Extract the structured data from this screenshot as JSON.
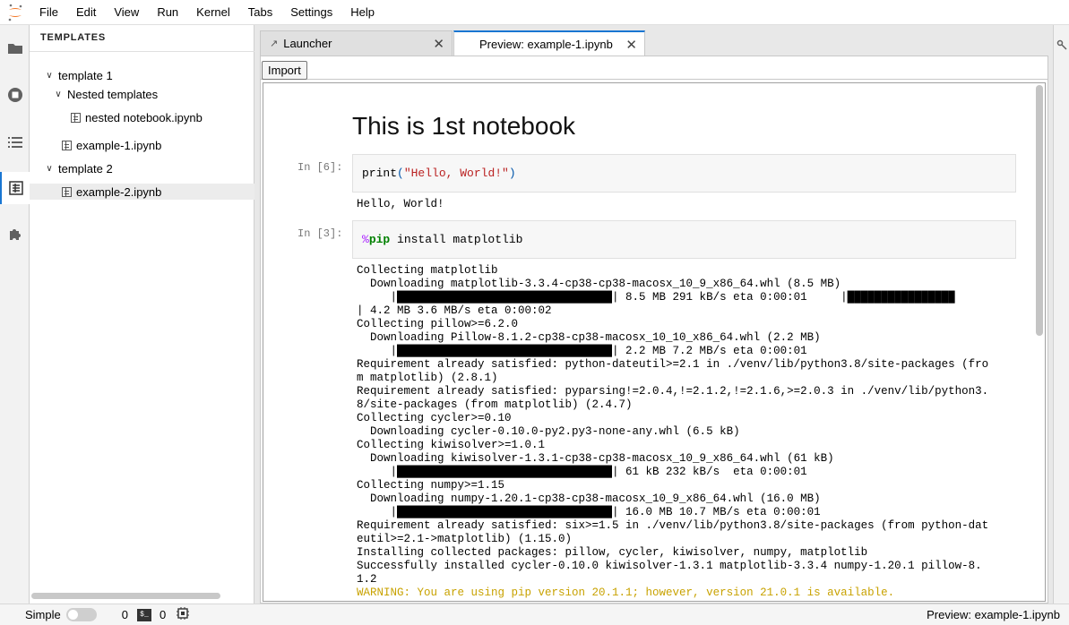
{
  "menubar": {
    "items": [
      "File",
      "Edit",
      "View",
      "Run",
      "Kernel",
      "Tabs",
      "Settings",
      "Help"
    ]
  },
  "activitybar": {
    "icons": [
      "folder-icon",
      "running-icon",
      "list-icon",
      "templates-icon",
      "extension-icon"
    ]
  },
  "sidebar": {
    "title": "TEMPLATES",
    "tree": [
      {
        "label": "template 1",
        "type": "folder"
      },
      {
        "label": "Nested templates",
        "type": "folder"
      },
      {
        "label": "nested notebook.ipynb",
        "type": "notebook"
      },
      {
        "label": "example-1.ipynb",
        "type": "notebook"
      },
      {
        "label": "template 2",
        "type": "folder"
      },
      {
        "label": "example-2.ipynb",
        "type": "notebook",
        "selected": true
      }
    ]
  },
  "tabs": [
    {
      "label": "Launcher",
      "active": false
    },
    {
      "label": "Preview: example-1.ipynb",
      "active": true
    }
  ],
  "toolbar": {
    "import_label": "Import"
  },
  "notebook": {
    "title": "This is 1st notebook",
    "cell1": {
      "prompt": "In [6]:",
      "code_fn": "print",
      "code_open": "(",
      "code_str": "\"Hello, World!\"",
      "code_close": ")",
      "output": "Hello, World!"
    },
    "cell2": {
      "prompt": "In [3]:",
      "magic_pct": "%",
      "magic_cmd": "pip",
      "code_rest": " install matplotlib",
      "output_lines": [
        "Collecting matplotlib",
        "  Downloading matplotlib-3.3.4-cp38-cp38-macosx_10_9_x86_64.whl (8.5 MB)",
        "     |████████████████████████████████| 8.5 MB 291 kB/s eta 0:00:01     |████████████████",
        "| 4.2 MB 3.6 MB/s eta 0:00:02",
        "Collecting pillow>=6.2.0",
        "  Downloading Pillow-8.1.2-cp38-cp38-macosx_10_10_x86_64.whl (2.2 MB)",
        "     |████████████████████████████████| 2.2 MB 7.2 MB/s eta 0:00:01",
        "Requirement already satisfied: python-dateutil>=2.1 in ./venv/lib/python3.8/site-packages (fro",
        "m matplotlib) (2.8.1)",
        "Requirement already satisfied: pyparsing!=2.0.4,!=2.1.2,!=2.1.6,>=2.0.3 in ./venv/lib/python3.",
        "8/site-packages (from matplotlib) (2.4.7)",
        "Collecting cycler>=0.10",
        "  Downloading cycler-0.10.0-py2.py3-none-any.whl (6.5 kB)",
        "Collecting kiwisolver>=1.0.1",
        "  Downloading kiwisolver-1.3.1-cp38-cp38-macosx_10_9_x86_64.whl (61 kB)",
        "     |████████████████████████████████| 61 kB 232 kB/s  eta 0:00:01",
        "Collecting numpy>=1.15",
        "  Downloading numpy-1.20.1-cp38-cp38-macosx_10_9_x86_64.whl (16.0 MB)",
        "     |████████████████████████████████| 16.0 MB 10.7 MB/s eta 0:00:01",
        "Requirement already satisfied: six>=1.5 in ./venv/lib/python3.8/site-packages (from python-dat",
        "eutil>=2.1->matplotlib) (1.15.0)",
        "Installing collected packages: pillow, cycler, kiwisolver, numpy, matplotlib",
        "Successfully installed cycler-0.10.0 kiwisolver-1.3.1 matplotlib-3.3.4 numpy-1.20.1 pillow-8.",
        "1.2"
      ],
      "warning": "WARNING: You are using pip version 20.1.1; however, version 21.0.1 is available."
    }
  },
  "statusbar": {
    "mode_label": "Simple",
    "terminals_count": "0",
    "kernels_count": "0",
    "right_text": "Preview: example-1.ipynb"
  },
  "colors": {
    "accent": "#1976d2",
    "warning": "#c8a200",
    "string": "#ba2121"
  }
}
